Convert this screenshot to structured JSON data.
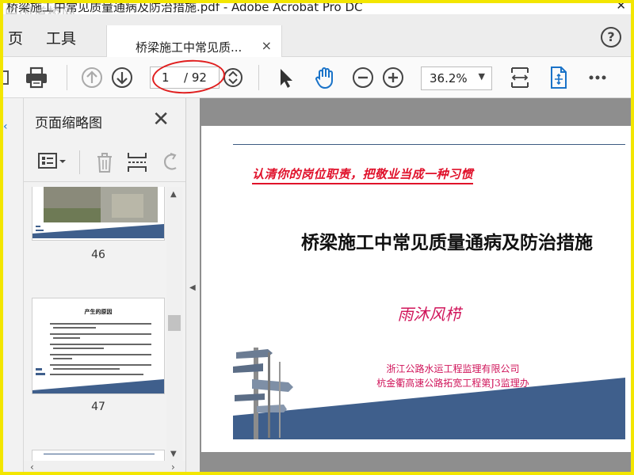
{
  "window": {
    "title": "桥梁施工中常见质量通病及防治措施.pdf - Adobe Acrobat Pro DC",
    "watermark": "中国道桥网"
  },
  "menu": {
    "items": [
      "页",
      "工具"
    ]
  },
  "tab": {
    "label": "桥梁施工中常见质...",
    "close_glyph": "×"
  },
  "toolbar": {
    "current_page": "1",
    "total_pages": "/ 92",
    "zoom": "36.2%"
  },
  "thumbnails": {
    "panel_title": "页面缩略图",
    "pages": [
      {
        "number": "46"
      },
      {
        "number": "47",
        "heading": "产生的原因"
      }
    ]
  },
  "document": {
    "slogan": "认清你的岗位职责，把敬业当成一种习惯",
    "title": "桥梁施工中常见质量通病及防治措施",
    "author": "雨沐风栉",
    "org_line1": "浙江公路水运工程监理有限公司",
    "org_line2": "杭金衢高速公路拓宽工程第J3监理办"
  },
  "colors": {
    "accent_blue": "#1a73c8",
    "slogan_red": "#e0102a",
    "author_magenta": "#d0145a",
    "band_blue": "#3f5f8c",
    "highlight_red": "#e01e1e"
  }
}
